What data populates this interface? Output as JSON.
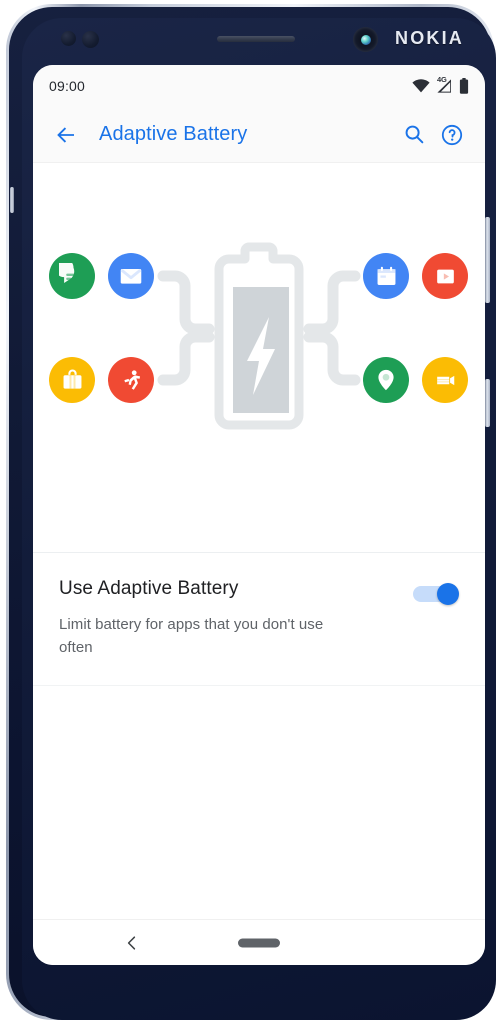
{
  "device": {
    "brand_logo": "NOKIA",
    "hardware": {
      "earpiece": "earpiece-speaker",
      "front_camera": "front-camera",
      "sensor_1": "proximity-sensor",
      "sensor_2": "light-sensor",
      "volume_button": "volume-rocker",
      "power_button": "power-button"
    }
  },
  "status_bar": {
    "time": "09:00",
    "icons": [
      {
        "name": "wifi-icon",
        "label": ""
      },
      {
        "name": "mobile-signal-icon",
        "label": "4G"
      },
      {
        "name": "battery-icon",
        "label": ""
      }
    ],
    "network_label": "4G"
  },
  "app_bar": {
    "back_icon": "back-arrow-icon",
    "title": "Adaptive Battery",
    "search_icon": "search-icon",
    "help_icon": "help-circle-icon",
    "accent_color": "#1a73e8"
  },
  "hero": {
    "center_graphic": "battery-with-lightning-bolt",
    "battery_color": "#e4e7e9",
    "battery_fill_color": "#cfd4d8",
    "connector_color": "#e4e7e9",
    "app_icons": [
      {
        "name": "messages-app-icon",
        "glyph": "speech-bubble",
        "color": "#1e9e55",
        "position": "top-left-1"
      },
      {
        "name": "mail-app-icon",
        "glyph": "envelope",
        "color": "#4285f4",
        "position": "top-left-2"
      },
      {
        "name": "shopping-bag-app-icon",
        "glyph": "briefcase",
        "color": "#fbbc04",
        "position": "bottom-left-1"
      },
      {
        "name": "fitness-app-icon",
        "glyph": "running-person",
        "color": "#f04a33",
        "position": "bottom-left-2"
      },
      {
        "name": "calendar-app-icon",
        "glyph": "calendar",
        "color": "#4285f4",
        "position": "top-right-1"
      },
      {
        "name": "video-app-icon",
        "glyph": "play-button",
        "color": "#f04a33",
        "position": "top-right-2"
      },
      {
        "name": "maps-app-icon",
        "glyph": "map-pin",
        "color": "#1e9e55",
        "position": "bottom-right-1"
      },
      {
        "name": "movies-app-icon",
        "glyph": "ticket",
        "color": "#fbbc04",
        "position": "bottom-right-2"
      }
    ]
  },
  "settings": {
    "rows": [
      {
        "name": "use-adaptive-battery",
        "title": "Use Adaptive Battery",
        "subtitle": "Limit battery for apps that you don't use often",
        "toggle_state": "on",
        "toggle_color": "#1a73e8"
      }
    ]
  },
  "nav_bar": {
    "back_icon": "nav-back-chevron-icon",
    "home_indicator": "home-pill-indicator"
  }
}
